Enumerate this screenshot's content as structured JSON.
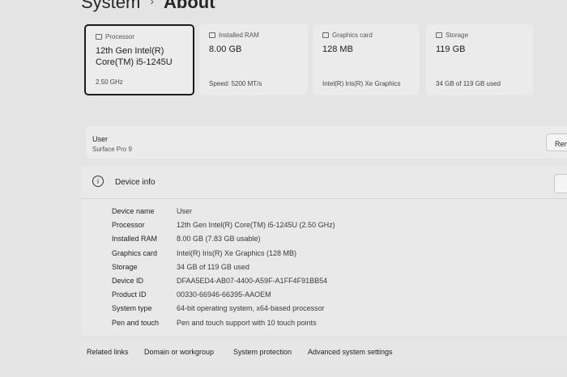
{
  "breadcrumb": {
    "parent": "System",
    "separator": "›",
    "current": "About"
  },
  "cards": [
    {
      "title": "Processor",
      "value": "12th Gen Intel(R) Core(TM) i5-1245U",
      "sub": "2.50 GHz",
      "icon": "cpu-icon"
    },
    {
      "title": "Installed RAM",
      "value": "8.00 GB",
      "sub": "Speed: 5200 MT/s",
      "icon": "memory-icon"
    },
    {
      "title": "Graphics card",
      "value": "128 MB",
      "sub": "Intel(R) Iris(R) Xe Graphics",
      "icon": "gpu-icon"
    },
    {
      "title": "Storage",
      "value": "119 GB",
      "sub": "34 GB of 119 GB used",
      "icon": "storage-icon"
    }
  ],
  "user_panel": {
    "label": "User",
    "device": "Surface Pro 9",
    "rename_label": "Ren"
  },
  "device_info": {
    "title": "Device info",
    "info_icon_glyph": "i",
    "rows": [
      {
        "key": "Device name",
        "value": "User"
      },
      {
        "key": "Processor",
        "value": "12th Gen Intel(R) Core(TM) i5-1245U (2.50 GHz)"
      },
      {
        "key": "Installed RAM",
        "value": "8.00 GB (7.83 GB usable)"
      },
      {
        "key": "Graphics card",
        "value": "Intel(R) Iris(R) Xe Graphics (128 MB)"
      },
      {
        "key": "Storage",
        "value": "34 GB of 119 GB used"
      },
      {
        "key": "Device ID",
        "value": "DFAA5ED4-AB07-4400-A59F-A1FF4F91BB54"
      },
      {
        "key": "Product ID",
        "value": "00330-66946-66395-AAOEM"
      },
      {
        "key": "System type",
        "value": "64-bit operating system, x64-based processor"
      },
      {
        "key": "Pen and touch",
        "value": "Pen and touch support with 10 touch points"
      }
    ]
  },
  "related": {
    "label": "Related links",
    "links": [
      "Domain or workgroup",
      "System protection",
      "Advanced system settings"
    ]
  }
}
